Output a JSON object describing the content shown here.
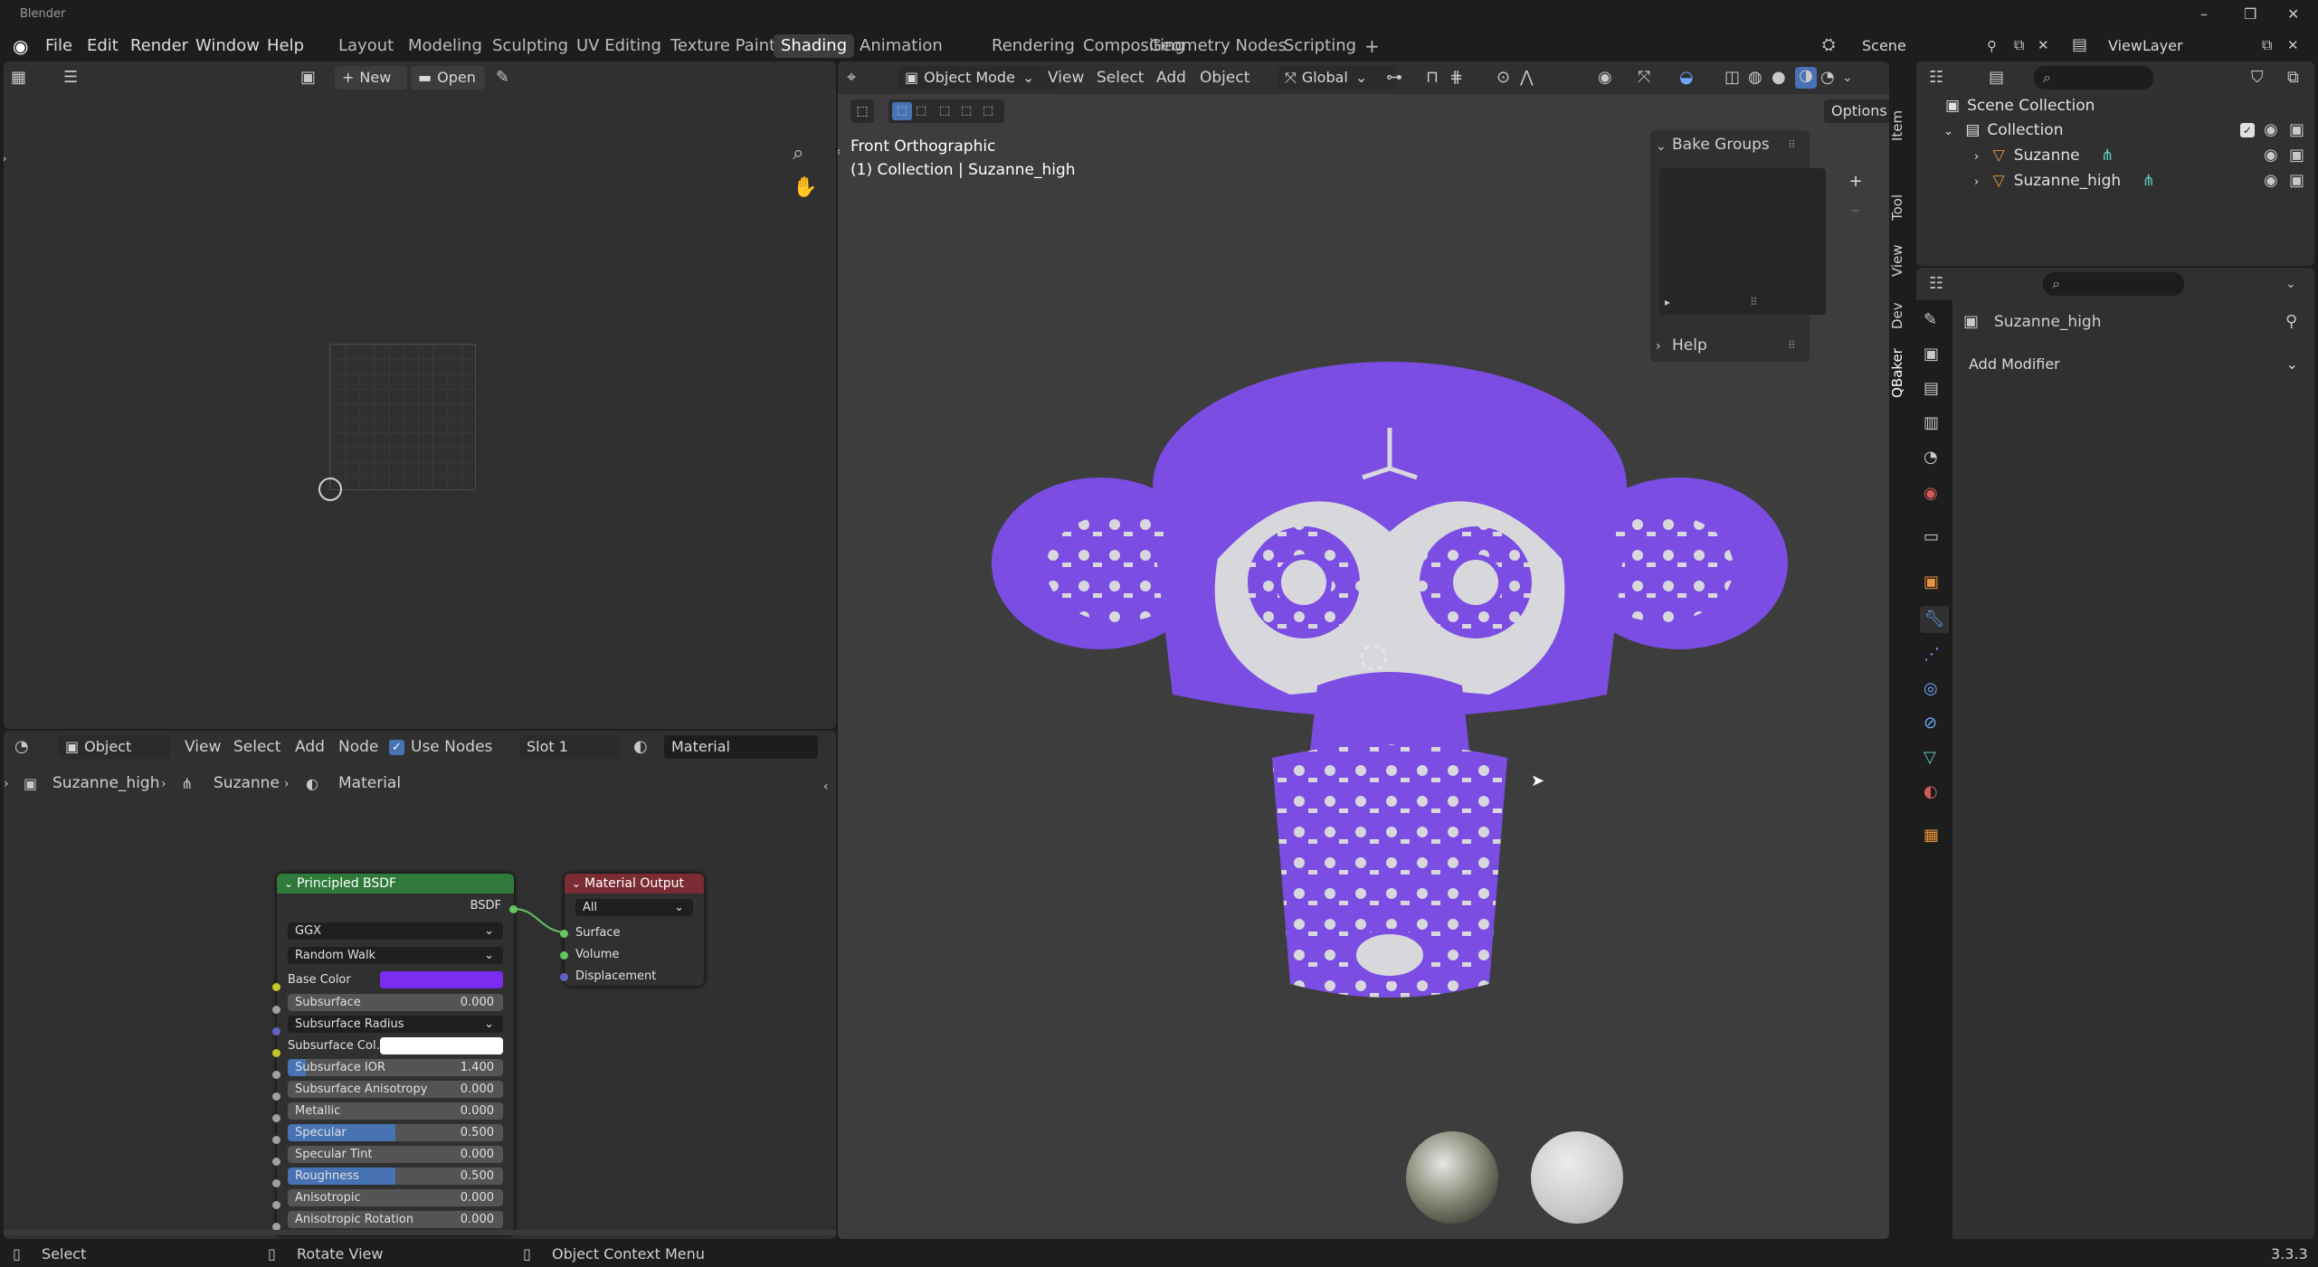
{
  "window": {
    "title": "Blender"
  },
  "menu": {
    "file": "File",
    "edit": "Edit",
    "render": "Render",
    "window": "Window",
    "help": "Help"
  },
  "workspaces": [
    {
      "label": "Layout"
    },
    {
      "label": "Modeling"
    },
    {
      "label": "Sculpting"
    },
    {
      "label": "UV Editing"
    },
    {
      "label": "Texture Paint"
    },
    {
      "label": "Shading"
    },
    {
      "label": "Animation"
    },
    {
      "label": "Rendering"
    },
    {
      "label": "Compositing"
    },
    {
      "label": "Geometry Nodes"
    },
    {
      "label": "Scripting"
    }
  ],
  "workspace_add": "+",
  "scene": {
    "name": "Scene",
    "view_layer": "ViewLayer"
  },
  "image_editor": {
    "new_label": "New",
    "open_label": "Open"
  },
  "viewport": {
    "mode": "Object Mode",
    "menus": {
      "view": "View",
      "select": "Select",
      "add": "Add",
      "object": "Object"
    },
    "orientation": "Global",
    "options": "Options",
    "view_name": "Front Orthographic",
    "collection_info": "(1) Collection | Suzanne_high",
    "side_tabs": {
      "item": "Item",
      "tool": "Tool",
      "view": "View",
      "dev": "Dev",
      "qbaker": "QBaker"
    },
    "panels": {
      "bake_groups": "Bake Groups",
      "help": "Help"
    },
    "colors": {
      "suzanne": "#7b4de3",
      "background": "#3d3d3d"
    }
  },
  "node_editor": {
    "editor_type": "Object",
    "menus": {
      "view": "View",
      "select": "Select",
      "add": "Add",
      "node": "Node"
    },
    "use_nodes": "Use Nodes",
    "slot": "Slot 1",
    "material": "Material",
    "breadcrumb": {
      "object": "Suzanne_high",
      "mesh": "Suzanne",
      "material": "Material"
    },
    "bsdf": {
      "title": "Principled BSDF",
      "output": "BSDF",
      "distribution": "GGX",
      "subsurface_method": "Random Walk",
      "base_color_label": "Base Color",
      "base_color": "#7a2cf0",
      "subsurface_label": "Subsurface",
      "subsurface": "0.000",
      "subsurface_radius": "Subsurface Radius",
      "subsurface_color_label": "Subsurface Col...",
      "subsurface_ior_label": "Subsurface IOR",
      "subsurface_ior": "1.400",
      "subsurface_aniso_label": "Subsurface Anisotropy",
      "subsurface_aniso": "0.000",
      "metallic_label": "Metallic",
      "metallic": "0.000",
      "specular_label": "Specular",
      "specular": "0.500",
      "specular_tint_label": "Specular Tint",
      "specular_tint": "0.000",
      "roughness_label": "Roughness",
      "roughness": "0.500",
      "anisotropic_label": "Anisotropic",
      "anisotropic": "0.000",
      "aniso_rot_label": "Anisotropic Rotation",
      "aniso_rot": "0.000"
    },
    "output": {
      "title": "Material Output",
      "target": "All",
      "surface": "Surface",
      "volume": "Volume",
      "displacement": "Displacement"
    }
  },
  "outliner": {
    "scene_collection": "Scene Collection",
    "collection": "Collection",
    "objects": [
      {
        "name": "Suzanne"
      },
      {
        "name": "Suzanne_high"
      }
    ]
  },
  "properties": {
    "object_name": "Suzanne_high",
    "add_modifier": "Add Modifier"
  },
  "statusbar": {
    "select": "Select",
    "rotate": "Rotate View",
    "context": "Object Context Menu",
    "version": "3.3.3"
  }
}
